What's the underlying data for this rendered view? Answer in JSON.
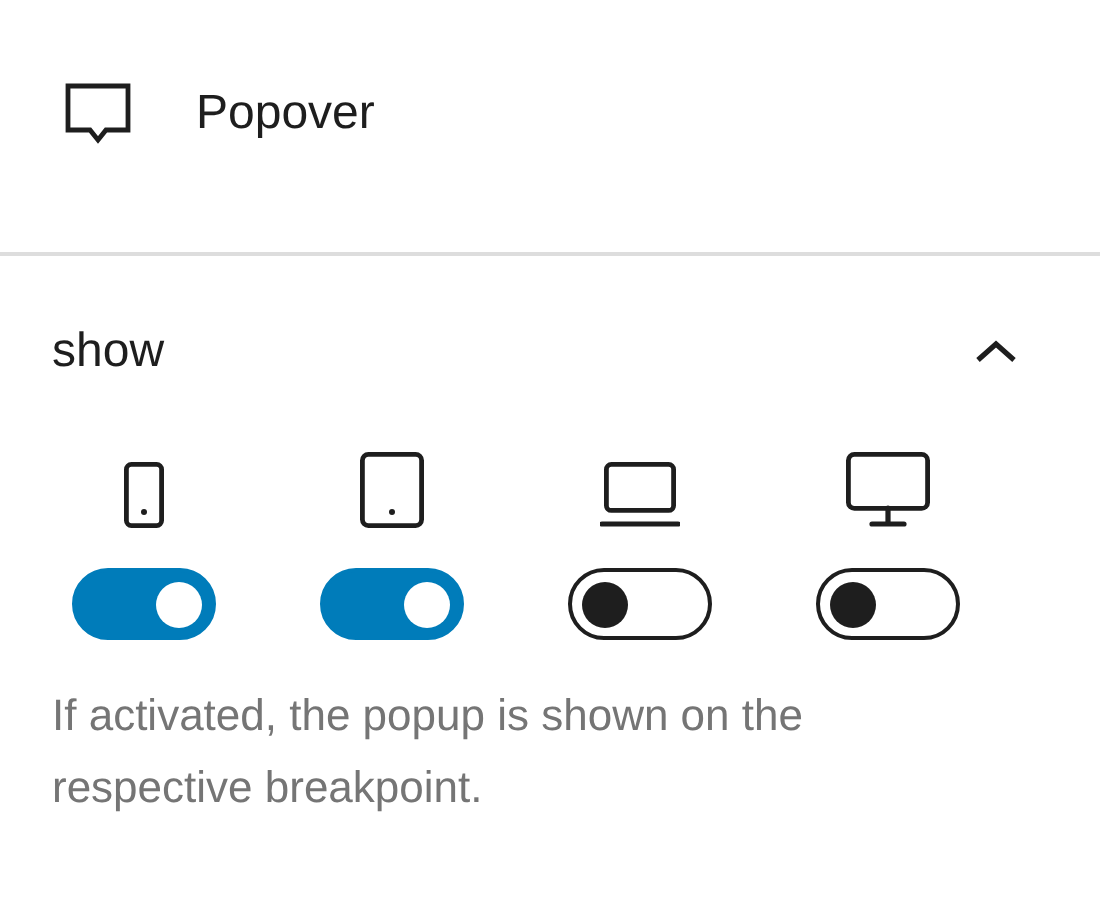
{
  "block": {
    "title": "Popover"
  },
  "panel": {
    "title": "show",
    "expanded": true,
    "devices": [
      {
        "kind": "phone",
        "on": true
      },
      {
        "kind": "tablet",
        "on": true
      },
      {
        "kind": "laptop",
        "on": false
      },
      {
        "kind": "desktop",
        "on": false
      }
    ],
    "help": "If activated, the popup is shown on the respective breakpoint."
  }
}
